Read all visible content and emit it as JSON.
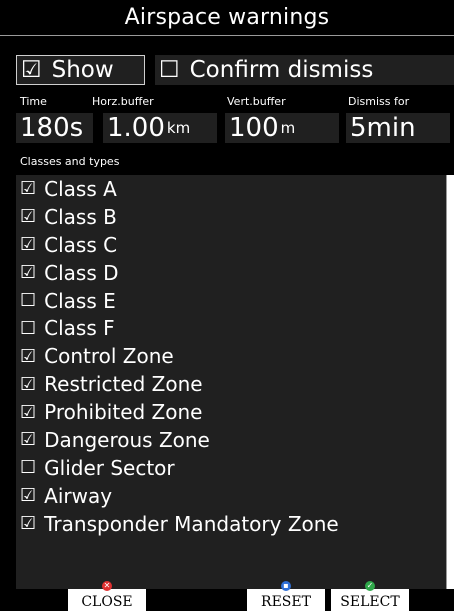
{
  "title": "Airspace warnings",
  "toggles": {
    "show": {
      "box": "☑",
      "label": "Show"
    },
    "confirm": {
      "box": "☐",
      "label": "Confirm dismiss"
    }
  },
  "fields": {
    "time": {
      "label": "Time",
      "value": "180s",
      "unit": ""
    },
    "horz": {
      "label": "Horz.buffer",
      "value": "1.00",
      "unit": "km"
    },
    "vert": {
      "label": "Vert.buffer",
      "value": "100",
      "unit": "m"
    },
    "dismiss": {
      "label": "Dismiss for",
      "value": "5min",
      "unit": ""
    }
  },
  "classes_label": "Classes and types",
  "classes": [
    {
      "box": "☑",
      "label": "Class A"
    },
    {
      "box": "☑",
      "label": "Class B"
    },
    {
      "box": "☑",
      "label": "Class C"
    },
    {
      "box": "☑",
      "label": "Class D"
    },
    {
      "box": "☐",
      "label": "Class E"
    },
    {
      "box": "☐",
      "label": "Class F"
    },
    {
      "box": "☑",
      "label": "Control Zone"
    },
    {
      "box": "☑",
      "label": "Restricted Zone"
    },
    {
      "box": "☑",
      "label": "Prohibited Zone"
    },
    {
      "box": "☑",
      "label": "Dangerous Zone"
    },
    {
      "box": "☐",
      "label": "Glider Sector"
    },
    {
      "box": "☑",
      "label": "Airway"
    },
    {
      "box": "☑",
      "label": "Transponder Mandatory Zone"
    }
  ],
  "buttons": {
    "close": {
      "label": "CLOSE",
      "key_color": "#e03030"
    },
    "reset": {
      "label": "RESET",
      "key_color": "#2f6fd6"
    },
    "select": {
      "label": "SELECT",
      "key_color": "#2fa84a"
    }
  }
}
